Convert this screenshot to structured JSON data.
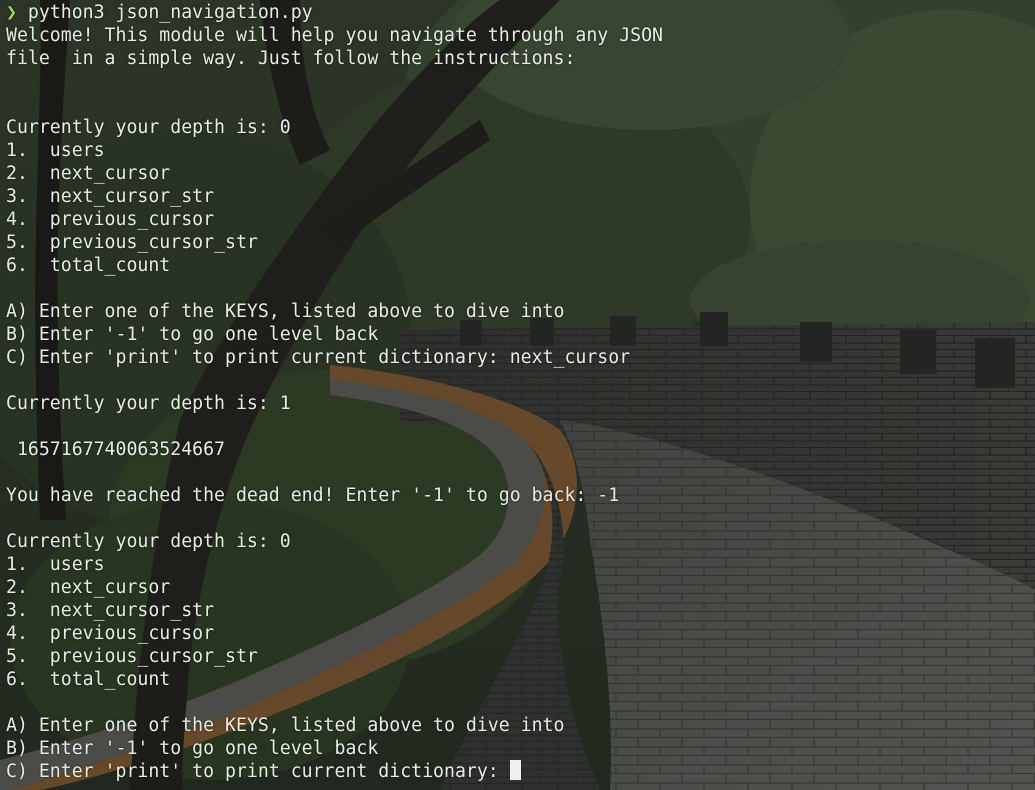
{
  "terminal": {
    "prompt_symbol": "❯",
    "command": "python3 json_navigation.py",
    "lines": [
      "Welcome! This module will help you navigate through any JSON",
      "file  in a simple way. Just follow the instructions:",
      "",
      "",
      "Currently your depth is: 0",
      "1.  users",
      "2.  next_cursor",
      "3.  next_cursor_str",
      "4.  previous_cursor",
      "5.  previous_cursor_str",
      "6.  total_count",
      "",
      "A) Enter one of the KEYS, listed above to dive into",
      "B) Enter '-1' to go one level back",
      "C) Enter 'print' to print current dictionary: next_cursor",
      "",
      "Currently your depth is: 1",
      "",
      " 1657167740063524667",
      "",
      "You have reached the dead end! Enter '-1' to go back: -1",
      "",
      "Currently your depth is: 0",
      "1.  users",
      "2.  next_cursor",
      "3.  next_cursor_str",
      "4.  previous_cursor",
      "5.  previous_cursor_str",
      "6.  total_count",
      "",
      "A) Enter one of the KEYS, listed above to dive into",
      "B) Enter '-1' to go one level back"
    ],
    "current_input_prompt": "C) Enter 'print' to print current dictionary: ",
    "cursor_icon": "block-cursor-icon",
    "colors": {
      "text": "#e7ece4",
      "prompt_arrow": "#9be24a",
      "cursor": "#eef1ec"
    }
  }
}
